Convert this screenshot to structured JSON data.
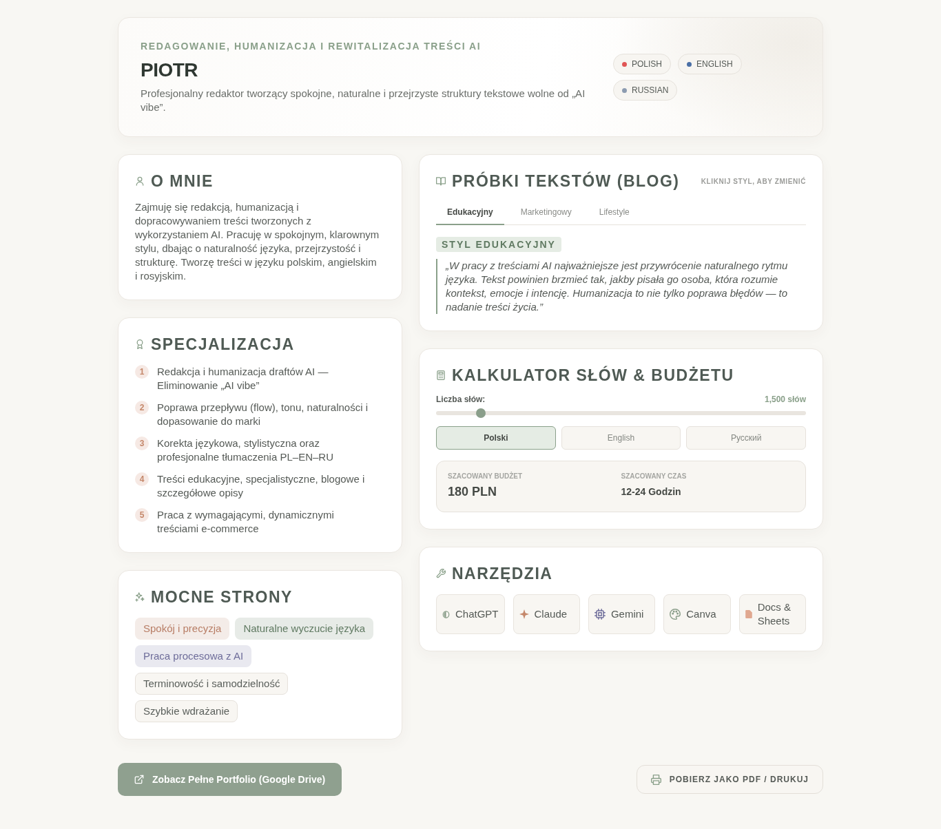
{
  "header": {
    "eyebrow": "REDAGOWANIE, HUMANIZACJA I REWITALIZACJA TREŚCI AI",
    "name": "PIOTR",
    "tagline": "Profesjonalny redaktor tworzący spokojne, naturalne i przejrzyste struktury tekstowe wolne od „AI vibe”.",
    "languages": [
      {
        "label": "POLISH",
        "color": "#e05555"
      },
      {
        "label": "ENGLISH",
        "color": "#4a6fa5"
      },
      {
        "label": "RUSSIAN",
        "color": "#8c9bb0"
      }
    ]
  },
  "about": {
    "title": "O MNIE",
    "text": "Zajmuję się redakcją, humanizacją i dopracowywaniem treści tworzonych z wykorzystaniem AI. Pracuję w spokojnym, klarownym stylu, dbając o naturalność języka, przejrzystość i strukturę. Tworzę treści w języku polskim, angielskim i rosyjskim."
  },
  "specialization": {
    "title": "SPECJALIZACJA",
    "items": [
      {
        "number": "1",
        "text": "Redakcja i humanizacja draftów AI — Eliminowanie „AI vibe”"
      },
      {
        "number": "2",
        "text": "Poprawa przepływu (flow), tonu, naturalności i dopasowanie do marki"
      },
      {
        "number": "3",
        "text": "Korekta językowa, stylistyczna oraz profesjonalne tłumaczenia PL–EN–RU"
      },
      {
        "number": "4",
        "text": "Treści edukacyjne, specjalistyczne, blogowe i szczegółowe opisy"
      },
      {
        "number": "5",
        "text": "Praca z wymagającymi, dynamicznymi treściami e-commerce"
      }
    ]
  },
  "strengths": {
    "title": "MOCNE STRONY",
    "tags": [
      {
        "label": "Spokój i precyzja",
        "kind": "soft",
        "color": "#b87e66"
      },
      {
        "label": "Naturalne wyczucie języka",
        "kind": "soft",
        "color": "#607a62"
      },
      {
        "label": "Praca procesowa z AI",
        "kind": "soft",
        "color": "#6e6d9a"
      },
      {
        "label": "Terminowość i samodzielność",
        "kind": "outline",
        "color": "#5a5f5b"
      },
      {
        "label": "Szybkie wdrażanie",
        "kind": "outline",
        "color": "#5a5f5b"
      }
    ]
  },
  "samples": {
    "title": "PRÓBKI TEKSTÓW (BLOG)",
    "hint": "KLIKNIJ STYL, ABY ZMIENIĆ",
    "tabs": [
      {
        "label": "Edukacyjny",
        "selected": true
      },
      {
        "label": "Marketingowy",
        "selected": false
      },
      {
        "label": "Lifestyle",
        "selected": false
      }
    ],
    "badge": "STYL EDUKACYJNY",
    "quote": "„W pracy z treściami AI najważniejsze jest przywrócenie naturalnego rytmu języka. Tekst powinien brzmieć tak, jakby pisała go osoba, która rozumie kontekst, emocje i intencję. Humanizacja to nie tylko poprawa błędów — to nadanie treści życia.”"
  },
  "calculator": {
    "title": "KALKULATOR SŁÓW & BUDŻETU",
    "words_label": "Liczba słów:",
    "words_value": "1,500 słów",
    "slider": {
      "level": 0.11
    },
    "languages": [
      {
        "label": "Polski",
        "selected": true
      },
      {
        "label": "English",
        "selected": false
      },
      {
        "label": "Русский",
        "selected": false
      }
    ],
    "budget": {
      "label": "SZACOWANY BUDŻET",
      "value": "180 PLN"
    },
    "time": {
      "label": "SZACOWANY CZAS",
      "value": "12-24 Godzin"
    }
  },
  "tools": {
    "title": "NARZĘDZIA",
    "items": [
      {
        "label": "ChatGPT",
        "color": "#8a9e8a"
      },
      {
        "label": "Claude",
        "color": "#c4876a"
      },
      {
        "label": "Gemini",
        "color": "#6e6d9a"
      },
      {
        "label": "Canva",
        "color": "#8a9e8a"
      },
      {
        "label": "Docs & Sheets",
        "color": "#e0a890"
      }
    ]
  },
  "actions": [
    {
      "label": "Zobacz Pełne Portfolio (Google Drive)",
      "kind": "primary"
    },
    {
      "label": "POBIERZ JAKO PDF / DRUKUJ",
      "kind": "secondary"
    }
  ]
}
